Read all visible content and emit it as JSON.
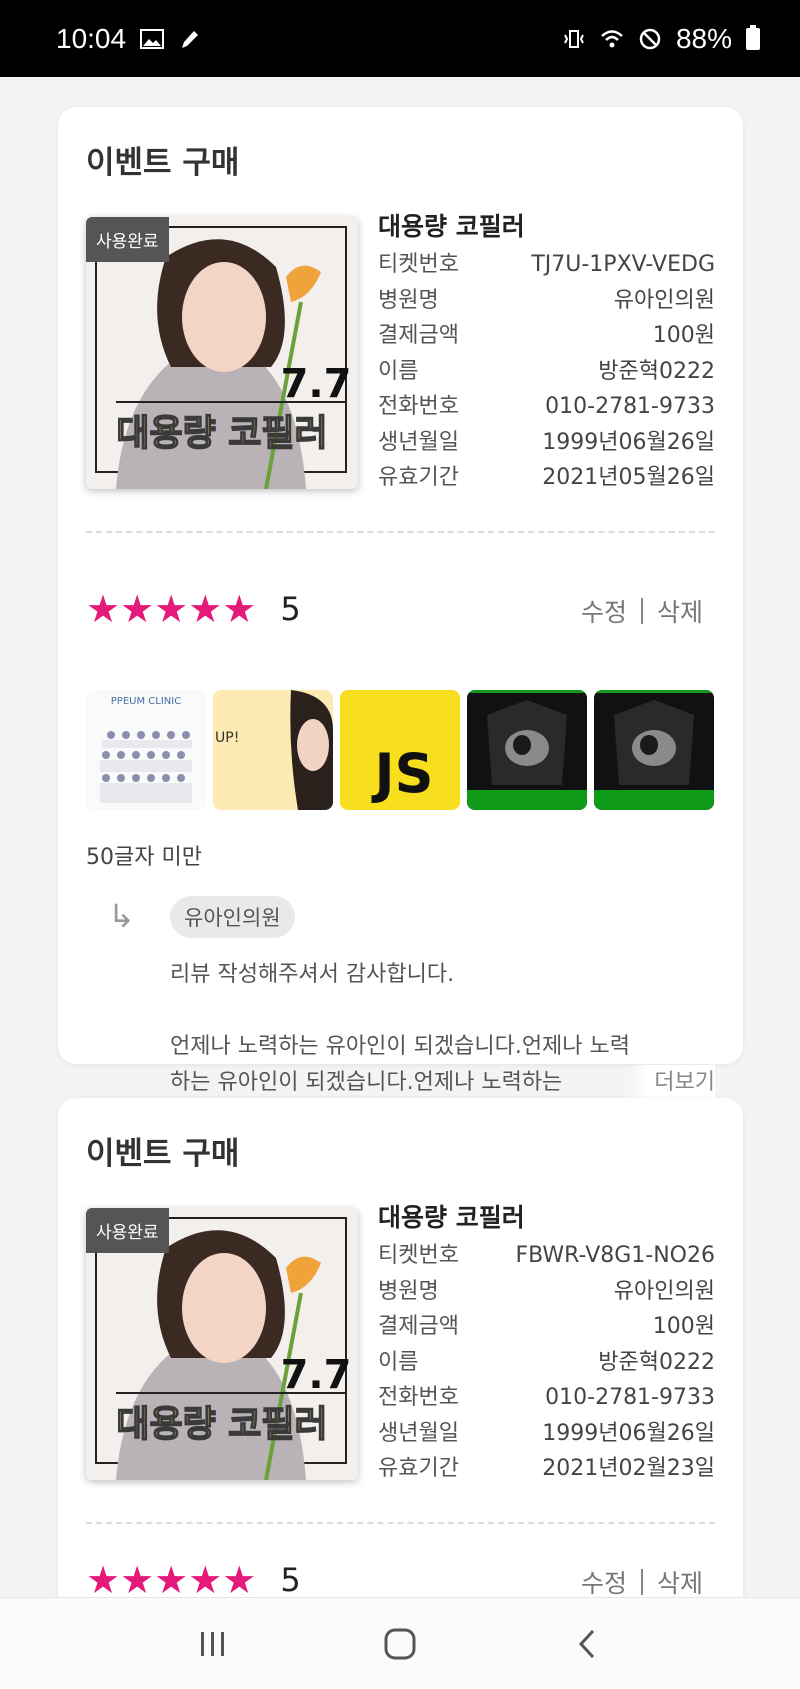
{
  "status_bar": {
    "time": "10:04",
    "battery": "88%"
  },
  "cards": [
    {
      "title": "이벤트 구매",
      "badge": "사용완료",
      "product_name": "대용량 코필러",
      "poster_number": "7.7",
      "poster_title": "대용량 코필러",
      "rows": [
        {
          "label": "티켓번호",
          "value": "TJ7U-1PXV-VEDG"
        },
        {
          "label": "병원명",
          "value": "유아인의원"
        },
        {
          "label": "결제금액",
          "value": "100원"
        },
        {
          "label": "이름",
          "value": "방준혁0222"
        },
        {
          "label": "전화번호",
          "value": "010-2781-9733"
        },
        {
          "label": "생년월일",
          "value": "1999년06월26일"
        },
        {
          "label": "유효기간",
          "value": "2021년05월26일"
        }
      ],
      "stars": "★★★★★",
      "score": "5",
      "edit_label": "수정",
      "delete_label": "삭제",
      "photos": {
        "clinic_label": "PPEUM CLINIC",
        "up_label": "UP!",
        "js_label": "JS"
      },
      "review_text": "50글자 미만",
      "reply": {
        "arrow": "↳",
        "author": "유아인의원",
        "line1": "리뷰 작성해주셔서 감사합니다.",
        "line2": "언제나 노력하는 유아인이 되겠습니다.언제나 노력",
        "line3": "하는 유아인이 되겠습니다.언제나 노력하는",
        "more_label": "더보기"
      }
    },
    {
      "title": "이벤트 구매",
      "badge": "사용완료",
      "product_name": "대용량 코필러",
      "poster_number": "7.7",
      "poster_title": "대용량 코필러",
      "rows": [
        {
          "label": "티켓번호",
          "value": "FBWR-V8G1-NO26"
        },
        {
          "label": "병원명",
          "value": "유아인의원"
        },
        {
          "label": "결제금액",
          "value": "100원"
        },
        {
          "label": "이름",
          "value": "방준혁0222"
        },
        {
          "label": "전화번호",
          "value": "010-2781-9733"
        },
        {
          "label": "생년월일",
          "value": "1999년06월26일"
        },
        {
          "label": "유효기간",
          "value": "2021년02월23일"
        }
      ],
      "stars": "★★★★★",
      "score": "5",
      "edit_label": "수정",
      "delete_label": "삭제"
    }
  ],
  "colors": {
    "star": "#e5197a",
    "badge_bg": "#555555",
    "js_yellow": "#f7df1e",
    "ultrasound_green": "#0f9a1a"
  },
  "nav_icons": [
    "recent-apps-icon",
    "home-icon",
    "back-icon"
  ]
}
